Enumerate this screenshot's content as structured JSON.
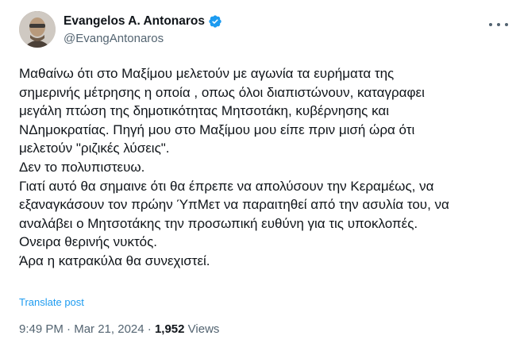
{
  "author": {
    "display_name": "Evangelos A. Antonaros",
    "handle": "@EvangAntonaros",
    "verified": true
  },
  "icons": {
    "verified": "verified-badge-icon",
    "more": "more-options-icon",
    "avatar": "profile-photo"
  },
  "tweet": {
    "lines": [
      "Μαθαίνω ότι στο Μαξίμου μελετούν με αγωνία τα ευρήματα της",
      "σημερινής μέτρησης η οποία , οπως όλοι διαπιστώνουν, καταγραφει",
      "μεγάλη πτώση της δημοτικότητας Μητσοτάκη, κυβέρνησης και",
      "ΝΔημοκρατίας. Πηγή μου στο Μαξίμου μου είπε πριν μισή ώρα ότι",
      "μελετούν \"ριζικές λύσεις\".",
      "Δεν το πολυπιστευω.",
      "Γιατί αυτό θα σημαινε ότι θα έπρεπε να απολύσουν την Κεραμέως, να",
      "εξαναγκάσουν τον πρώην ΎπΜετ να παραιτηθεί από την ασυλία του, να",
      "αναλάβει ο Μητσοτάκης την προσωπική ευθύνη για τις υποκλοπές.",
      "Ονειρα θερινής νυκτός.",
      "Άρα η κατρακύλα θα συνεχιστεί."
    ],
    "translate_label": "Translate post"
  },
  "meta": {
    "time": "9:49 PM",
    "separator": "·",
    "date": "Mar 21, 2024",
    "views_count": "1,952",
    "views_label": "Views"
  },
  "colors": {
    "text": "#0f1419",
    "secondary": "#536471",
    "accent": "#1d9bf0"
  }
}
